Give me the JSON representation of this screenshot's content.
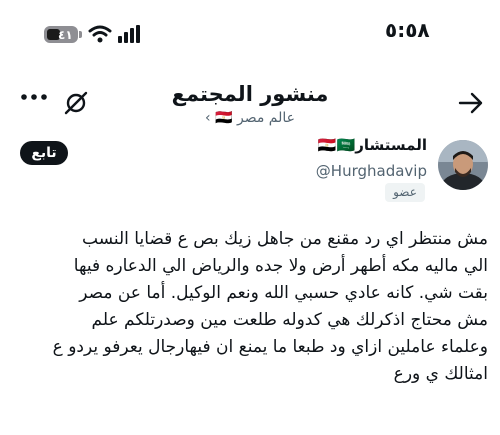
{
  "status_bar": {
    "time": "٥:٥٨",
    "battery_level": "٤١"
  },
  "header": {
    "title": "منشور المجتمع",
    "community_link": "عالم مصر 🇪🇬 ›"
  },
  "join_button": "تابع",
  "author": {
    "name": "المستشار🇪🇬🇸🇦",
    "handle": "@Hurghadavip",
    "badge": "عضو"
  },
  "post": {
    "lines": [
      "مش منتظر اي رد مقنع  من جاهل زيك  بص ع قضايا النسب",
      "الي ماليه مكه أطهر أرض ولا جده والرياض الي الدعاره فيها",
      "بقت شي. كانه عادي حسبي الله ونعم الوكيل.   أما عن مصر",
      "مش محتاج اذكرلك هي كدوله طلعت مين وصدرتلكم علم",
      "وعلماء عاملين ازاي ود طبعا ما يمنع ان فيهارجال يعرفو يردو ع",
      "امثالك ي ورع"
    ]
  },
  "colors": {
    "text": "#0f1419",
    "secondary": "#536471",
    "button_bg": "#0f1419"
  },
  "icons": [
    "back-arrow-icon",
    "mute-icon",
    "more-icon",
    "wifi-icon",
    "signal-icon",
    "battery-icon"
  ]
}
